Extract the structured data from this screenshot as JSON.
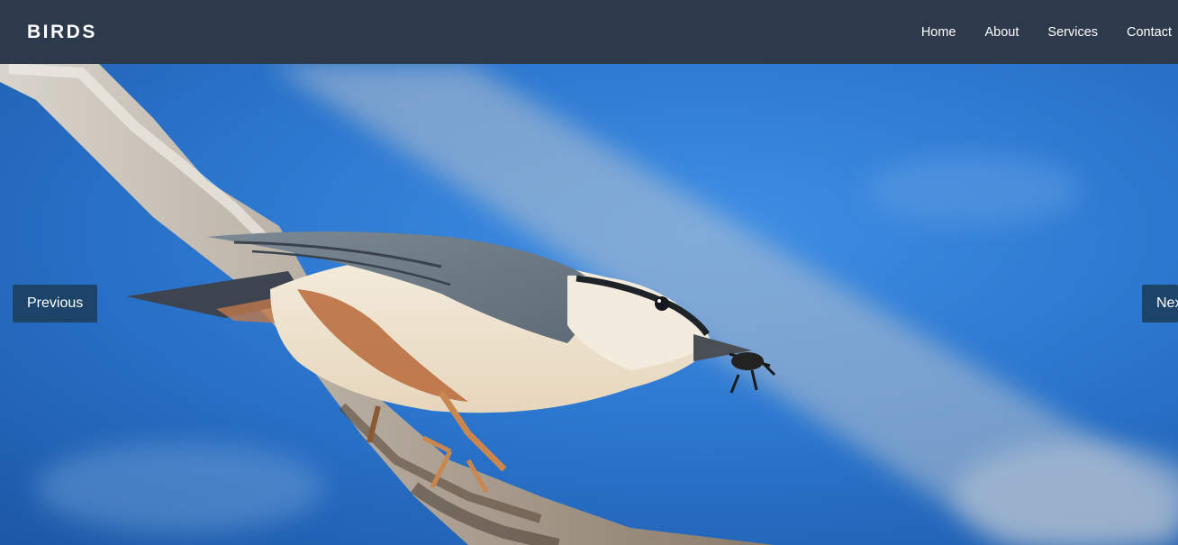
{
  "navbar": {
    "brand": "BIRDS",
    "links": [
      {
        "label": "Home"
      },
      {
        "label": "About"
      },
      {
        "label": "Services"
      },
      {
        "label": "Contact"
      }
    ],
    "background": "#2c3a4c"
  },
  "slider": {
    "previous_label": "Previous",
    "next_label": "Next",
    "button_color": "#1c4468"
  },
  "hero": {
    "image_icon": "bird-photo"
  }
}
